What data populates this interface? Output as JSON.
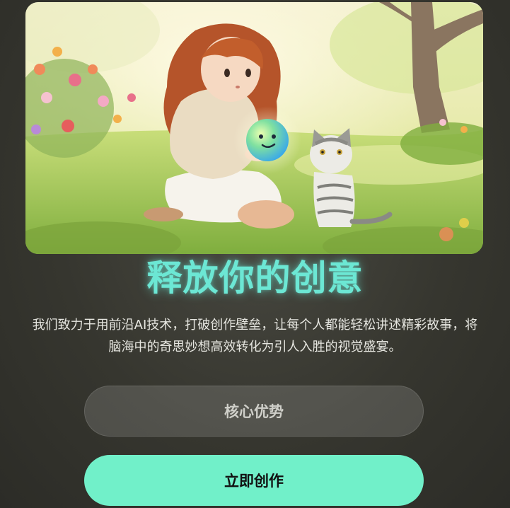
{
  "hero": {
    "image_alt": "illustration-girl-holding-glowing-orb-with-cat",
    "orb_face": "smiley-face-icon"
  },
  "headline": "释放你的创意",
  "description": "我们致力于用前沿AI技术，打破创作壁垒，让每个人都能轻松讲述精彩故事，将脑海中的奇思妙想高效转化为引人入胜的视觉盛宴。",
  "buttons": {
    "secondary_label": "核心优势",
    "primary_label": "立即创作"
  },
  "colors": {
    "accent": "#6ce7d4",
    "primary_button": "#71f0c9"
  }
}
